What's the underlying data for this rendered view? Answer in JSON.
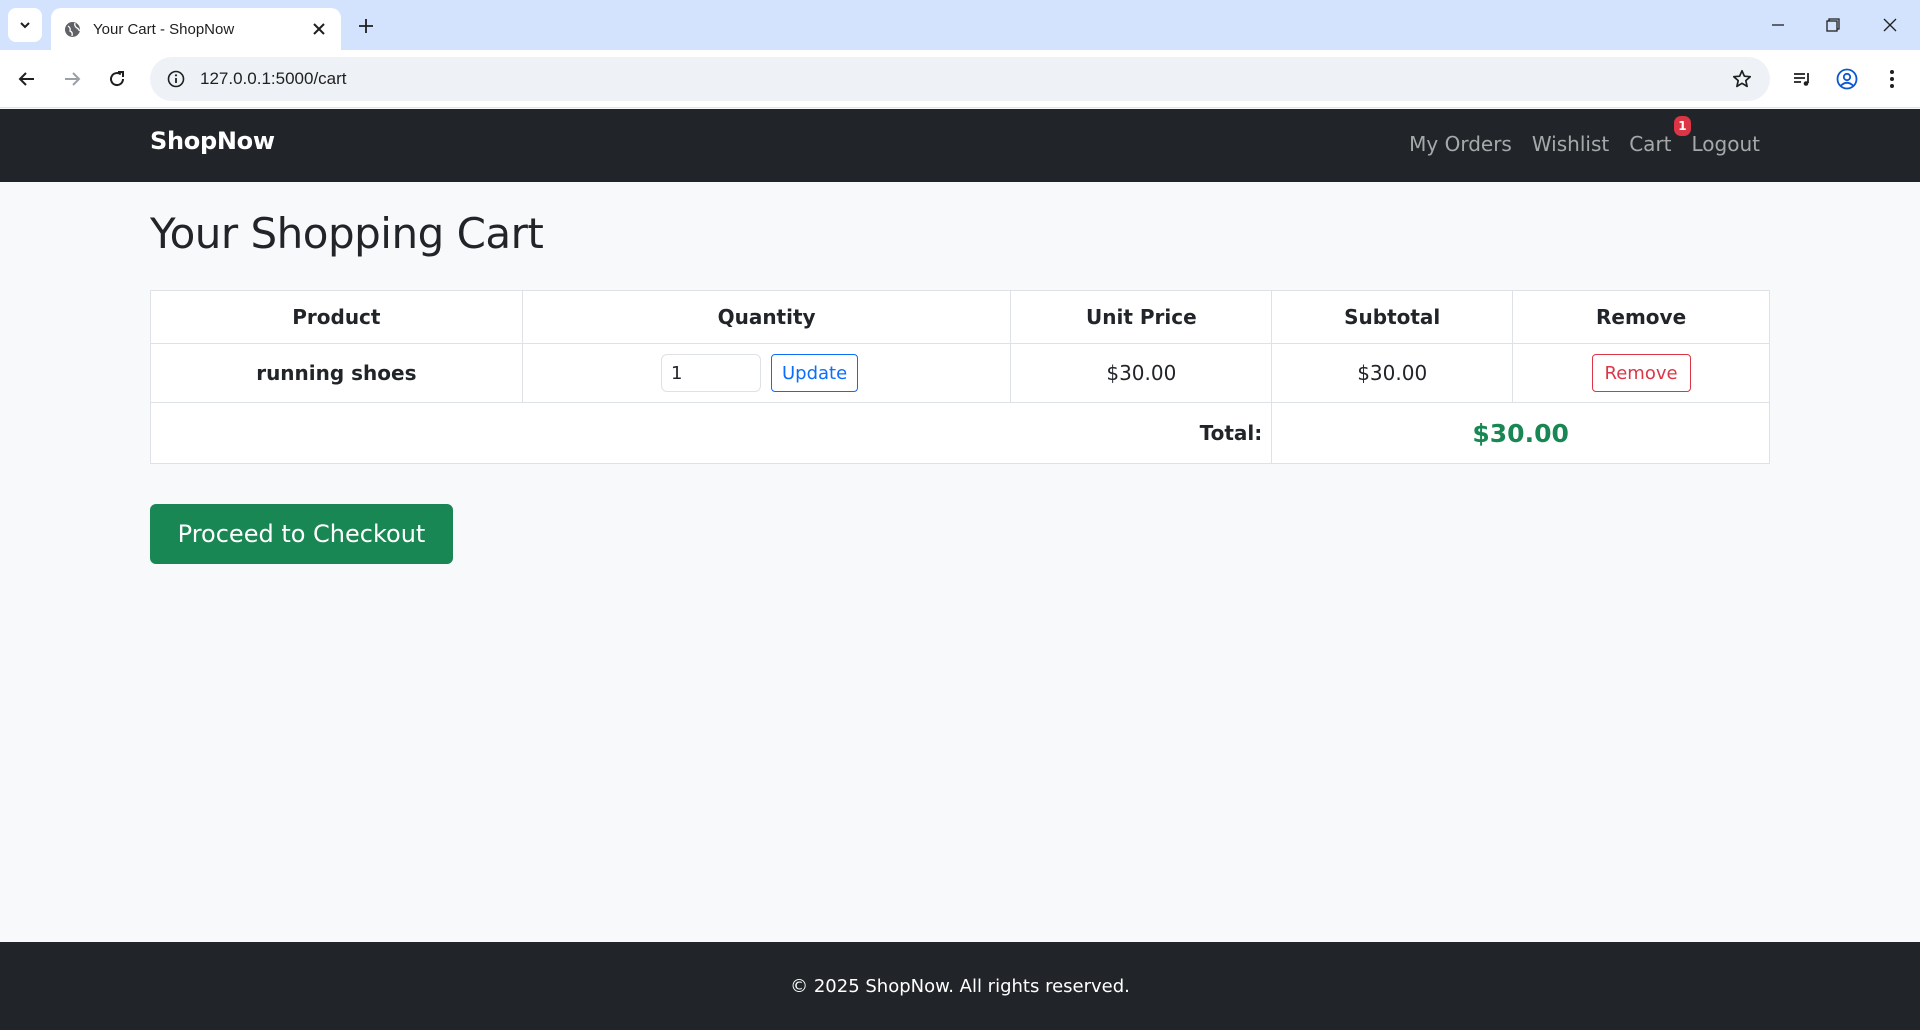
{
  "browser": {
    "tab_title": "Your Cart - ShopNow",
    "url": "127.0.0.1:5000/cart"
  },
  "navbar": {
    "brand": "ShopNow",
    "links": [
      "My Orders",
      "Wishlist",
      "Cart",
      "Logout"
    ],
    "cart_badge": "1"
  },
  "page": {
    "title": "Your Shopping Cart"
  },
  "cart": {
    "headers": [
      "Product",
      "Quantity",
      "Unit Price",
      "Subtotal",
      "Remove"
    ],
    "items": [
      {
        "product": "running shoes",
        "quantity": "1",
        "update_label": "Update",
        "unit_price": "$30.00",
        "subtotal": "$30.00",
        "remove_label": "Remove"
      }
    ],
    "total_label": "Total:",
    "total_value": "$30.00",
    "checkout_label": "Proceed to Checkout"
  },
  "footer": {
    "text": "© 2025 ShopNow. All rights reserved."
  },
  "colors": {
    "navbar_bg": "#212529",
    "success": "#198754",
    "primary": "#0d6efd",
    "danger": "#dc3545",
    "page_bg": "#f8f9fa",
    "chrome_tabstrip": "#d3e3fd"
  }
}
